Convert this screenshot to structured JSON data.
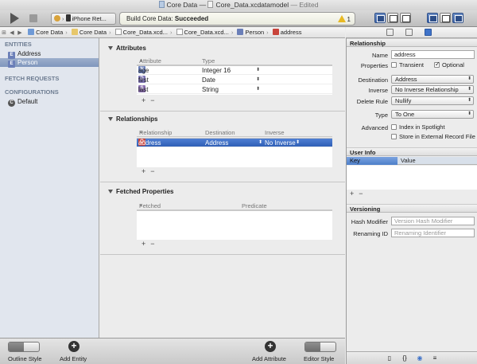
{
  "window": {
    "title_project": "Core Data",
    "title_sep": " — ",
    "title_file": "Core_Data.xcdatamodel",
    "title_edited": " — Edited"
  },
  "toolbar": {
    "scheme": "iPhone Ret...",
    "activity_prefix": "Build Core Data: ",
    "activity_status": "Succeeded",
    "warning_count": "1"
  },
  "jumpbar": {
    "crumbs": [
      "Core Data",
      "Core Data",
      "Core_Data.xcd...",
      "Core_Data.xcd...",
      "Person",
      "address"
    ]
  },
  "sidebar": {
    "entities_header": "ENTITIES",
    "entities": [
      {
        "badge": "E",
        "label": "Address"
      },
      {
        "badge": "E",
        "label": "Person"
      }
    ],
    "fetch_header": "FETCH REQUESTS",
    "config_header": "CONFIGURATIONS",
    "configs": [
      {
        "badge": "C",
        "label": "Default"
      }
    ]
  },
  "attributes": {
    "title": "Attributes",
    "col_attribute": "Attribute",
    "col_type": "Type",
    "rows": [
      {
        "badge": "N",
        "name": "age",
        "type": "Integer 16"
      },
      {
        "badge": "D",
        "name": "first",
        "type": "Date"
      },
      {
        "badge": "S",
        "name": "last",
        "type": "String"
      }
    ]
  },
  "relationships": {
    "title": "Relationships",
    "col_relationship": "Relationship",
    "col_destination": "Destination",
    "col_inverse": "Inverse",
    "rows": [
      {
        "badge": "O",
        "name": "address",
        "destination": "Address",
        "inverse": "No Inverse"
      }
    ]
  },
  "fetched": {
    "title": "Fetched Properties",
    "col_property": "Fetched Property",
    "col_predicate": "Predicate"
  },
  "bottom": {
    "outline_style": "Outline Style",
    "add_entity": "Add Entity",
    "add_attribute": "Add Attribute",
    "editor_style": "Editor Style"
  },
  "inspector": {
    "relationship_header": "Relationship",
    "name_label": "Name",
    "name_value": "address",
    "properties_label": "Properties",
    "transient_label": "Transient",
    "optional_label": "Optional",
    "destination_label": "Destination",
    "destination_value": "Address",
    "inverse_label": "Inverse",
    "inverse_value": "No Inverse Relationship",
    "delete_rule_label": "Delete Rule",
    "delete_rule_value": "Nullify",
    "type_label": "Type",
    "type_value": "To One",
    "advanced_label": "Advanced",
    "index_label": "Index in Spotlight",
    "store_label": "Store in External Record File",
    "userinfo_header": "User Info",
    "key_col": "Key",
    "value_col": "Value",
    "versioning_header": "Versioning",
    "hash_label": "Hash Modifier",
    "hash_placeholder": "Version Hash Modifier",
    "renaming_label": "Renaming ID",
    "renaming_placeholder": "Renaming Identifier"
  },
  "icons": {
    "sort_asc": "▲",
    "updown": "⬍",
    "plus": "+",
    "minus": "−",
    "nav_back": "◀",
    "nav_fwd": "▶",
    "grid": "⊞",
    "warn": "⚠",
    "add": "+",
    "ft_doc": "▯",
    "ft_braces": "{}",
    "ft_cube": "◉",
    "ft_list": "≡"
  },
  "colors": {
    "selection": "#3f6fc4",
    "sidebar_bg": "#e1e6ee",
    "header_text": "#6d7c91"
  }
}
